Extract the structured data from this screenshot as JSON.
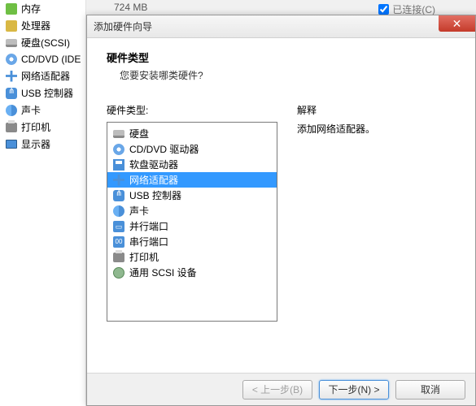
{
  "bg": {
    "value": "724 MB",
    "checkbox_label": "已连接(C)",
    "sidebar": [
      {
        "label": "内存",
        "icon": "chip"
      },
      {
        "label": "处理器",
        "icon": "cpu"
      },
      {
        "label": "硬盘(SCSI)",
        "icon": "hdd"
      },
      {
        "label": "CD/DVD (IDE",
        "icon": "cd"
      },
      {
        "label": "网络适配器",
        "icon": "net",
        "selected": true
      },
      {
        "label": "USB 控制器",
        "icon": "usb"
      },
      {
        "label": "声卡",
        "icon": "snd"
      },
      {
        "label": "打印机",
        "icon": "printer"
      },
      {
        "label": "显示器",
        "icon": "monitor"
      }
    ]
  },
  "dialog": {
    "title": "添加硬件向导",
    "heading": "硬件类型",
    "subheading": "您要安装哪类硬件?",
    "list_label": "硬件类型:",
    "desc_label": "解释",
    "desc_text": "添加网络适配器。",
    "items": [
      {
        "label": "硬盘",
        "icon": "hdd"
      },
      {
        "label": "CD/DVD 驱动器",
        "icon": "cd"
      },
      {
        "label": "软盘驱动器",
        "icon": "floppy"
      },
      {
        "label": "网络适配器",
        "icon": "net",
        "selected": true
      },
      {
        "label": "USB 控制器",
        "icon": "usb"
      },
      {
        "label": "声卡",
        "icon": "snd"
      },
      {
        "label": "并行端口",
        "icon": "port"
      },
      {
        "label": "串行端口",
        "icon": "serial"
      },
      {
        "label": "打印机",
        "icon": "printer"
      },
      {
        "label": "通用 SCSI 设备",
        "icon": "scsi"
      }
    ],
    "buttons": {
      "back": "< 上一步(B)",
      "next": "下一步(N) >",
      "cancel": "取消"
    }
  }
}
